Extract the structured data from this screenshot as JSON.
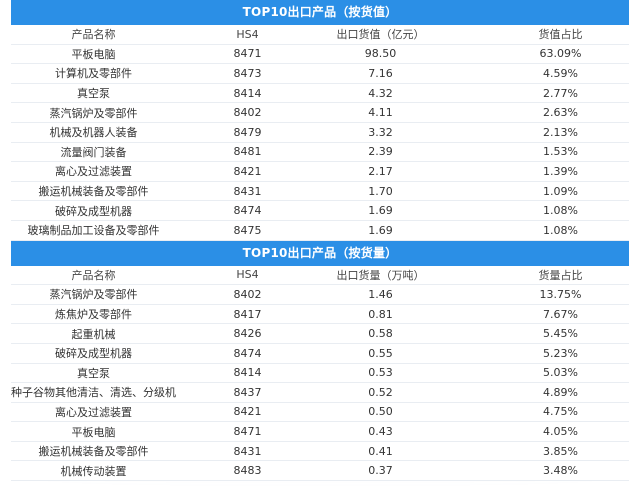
{
  "sections": [
    {
      "title": "TOP10出口产品（按货值）",
      "headers": [
        "产品名称",
        "HS4",
        "出口货值（亿元）",
        "货值占比"
      ],
      "rows": [
        [
          "平板电脑",
          "8471",
          "98.50",
          "63.09%"
        ],
        [
          "计算机及零部件",
          "8473",
          "7.16",
          "4.59%"
        ],
        [
          "真空泵",
          "8414",
          "4.32",
          "2.77%"
        ],
        [
          "蒸汽锅炉及零部件",
          "8402",
          "4.11",
          "2.63%"
        ],
        [
          "机械及机器人装备",
          "8479",
          "3.32",
          "2.13%"
        ],
        [
          "流量阀门装备",
          "8481",
          "2.39",
          "1.53%"
        ],
        [
          "离心及过滤装置",
          "8421",
          "2.17",
          "1.39%"
        ],
        [
          "搬运机械装备及零部件",
          "8431",
          "1.70",
          "1.09%"
        ],
        [
          "破碎及成型机器",
          "8474",
          "1.69",
          "1.08%"
        ],
        [
          "玻璃制品加工设备及零部件",
          "8475",
          "1.69",
          "1.08%"
        ]
      ]
    },
    {
      "title": "TOP10出口产品（按货量）",
      "headers": [
        "产品名称",
        "HS4",
        "出口货量（万吨）",
        "货量占比"
      ],
      "rows": [
        [
          "蒸汽锅炉及零部件",
          "8402",
          "1.46",
          "13.75%"
        ],
        [
          "炼焦炉及零部件",
          "8417",
          "0.81",
          "7.67%"
        ],
        [
          "起重机械",
          "8426",
          "0.58",
          "5.45%"
        ],
        [
          "破碎及成型机器",
          "8474",
          "0.55",
          "5.23%"
        ],
        [
          "真空泵",
          "8414",
          "0.53",
          "5.03%"
        ],
        [
          "种子谷物其他清洁、清选、分级机",
          "8437",
          "0.52",
          "4.89%"
        ],
        [
          "离心及过滤装置",
          "8421",
          "0.50",
          "4.75%"
        ],
        [
          "平板电脑",
          "8471",
          "0.43",
          "4.05%"
        ],
        [
          "搬运机械装备及零部件",
          "8431",
          "0.41",
          "3.85%"
        ],
        [
          "机械传动装置",
          "8483",
          "0.37",
          "3.48%"
        ]
      ]
    }
  ]
}
